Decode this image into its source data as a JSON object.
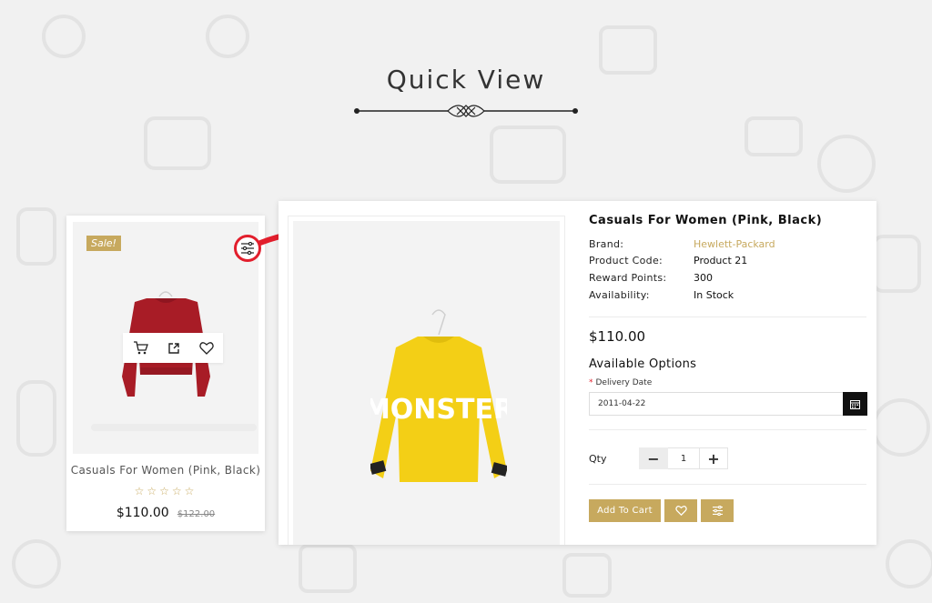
{
  "header": {
    "title": "Quick View"
  },
  "card": {
    "sale_badge": "Sale!",
    "product_name": "Casuals For Women (Pink, Black)",
    "rating": 0,
    "rating_max": 5,
    "stars": "☆☆☆☆☆",
    "price": "$110.00",
    "old_price": "$122.00",
    "actions": [
      "cart-icon",
      "external-link-icon",
      "heart-icon"
    ],
    "quickview_icon": "sliders-icon",
    "highlight_color": "#e21e2c"
  },
  "modal": {
    "title": "Casuals For Women (Pink, Black)",
    "meta": [
      {
        "label": "Brand:",
        "value": "Hewlett-Packard"
      },
      {
        "label": "Product Code:",
        "value": "Product 21"
      },
      {
        "label": "Reward Points:",
        "value": "300"
      },
      {
        "label": "Availability:",
        "value": "In Stock"
      }
    ],
    "price": "$110.00",
    "options_title": "Available Options",
    "delivery_required_mark": "*",
    "delivery_label": "Delivery Date",
    "delivery_value": "2011-04-22",
    "calendar_icon": "calendar-icon",
    "qty_label": "Qty",
    "qty_minus": "−",
    "qty_value": "1",
    "qty_plus": "+",
    "add_to_cart_label": "Add To Cart",
    "wishlist_icon": "heart-icon",
    "compare_icon": "sliders-icon"
  },
  "colors": {
    "accent": "#c7a95e",
    "background": "#f1f1f1",
    "arrow": "#e21e2c",
    "dark": "#111111"
  }
}
